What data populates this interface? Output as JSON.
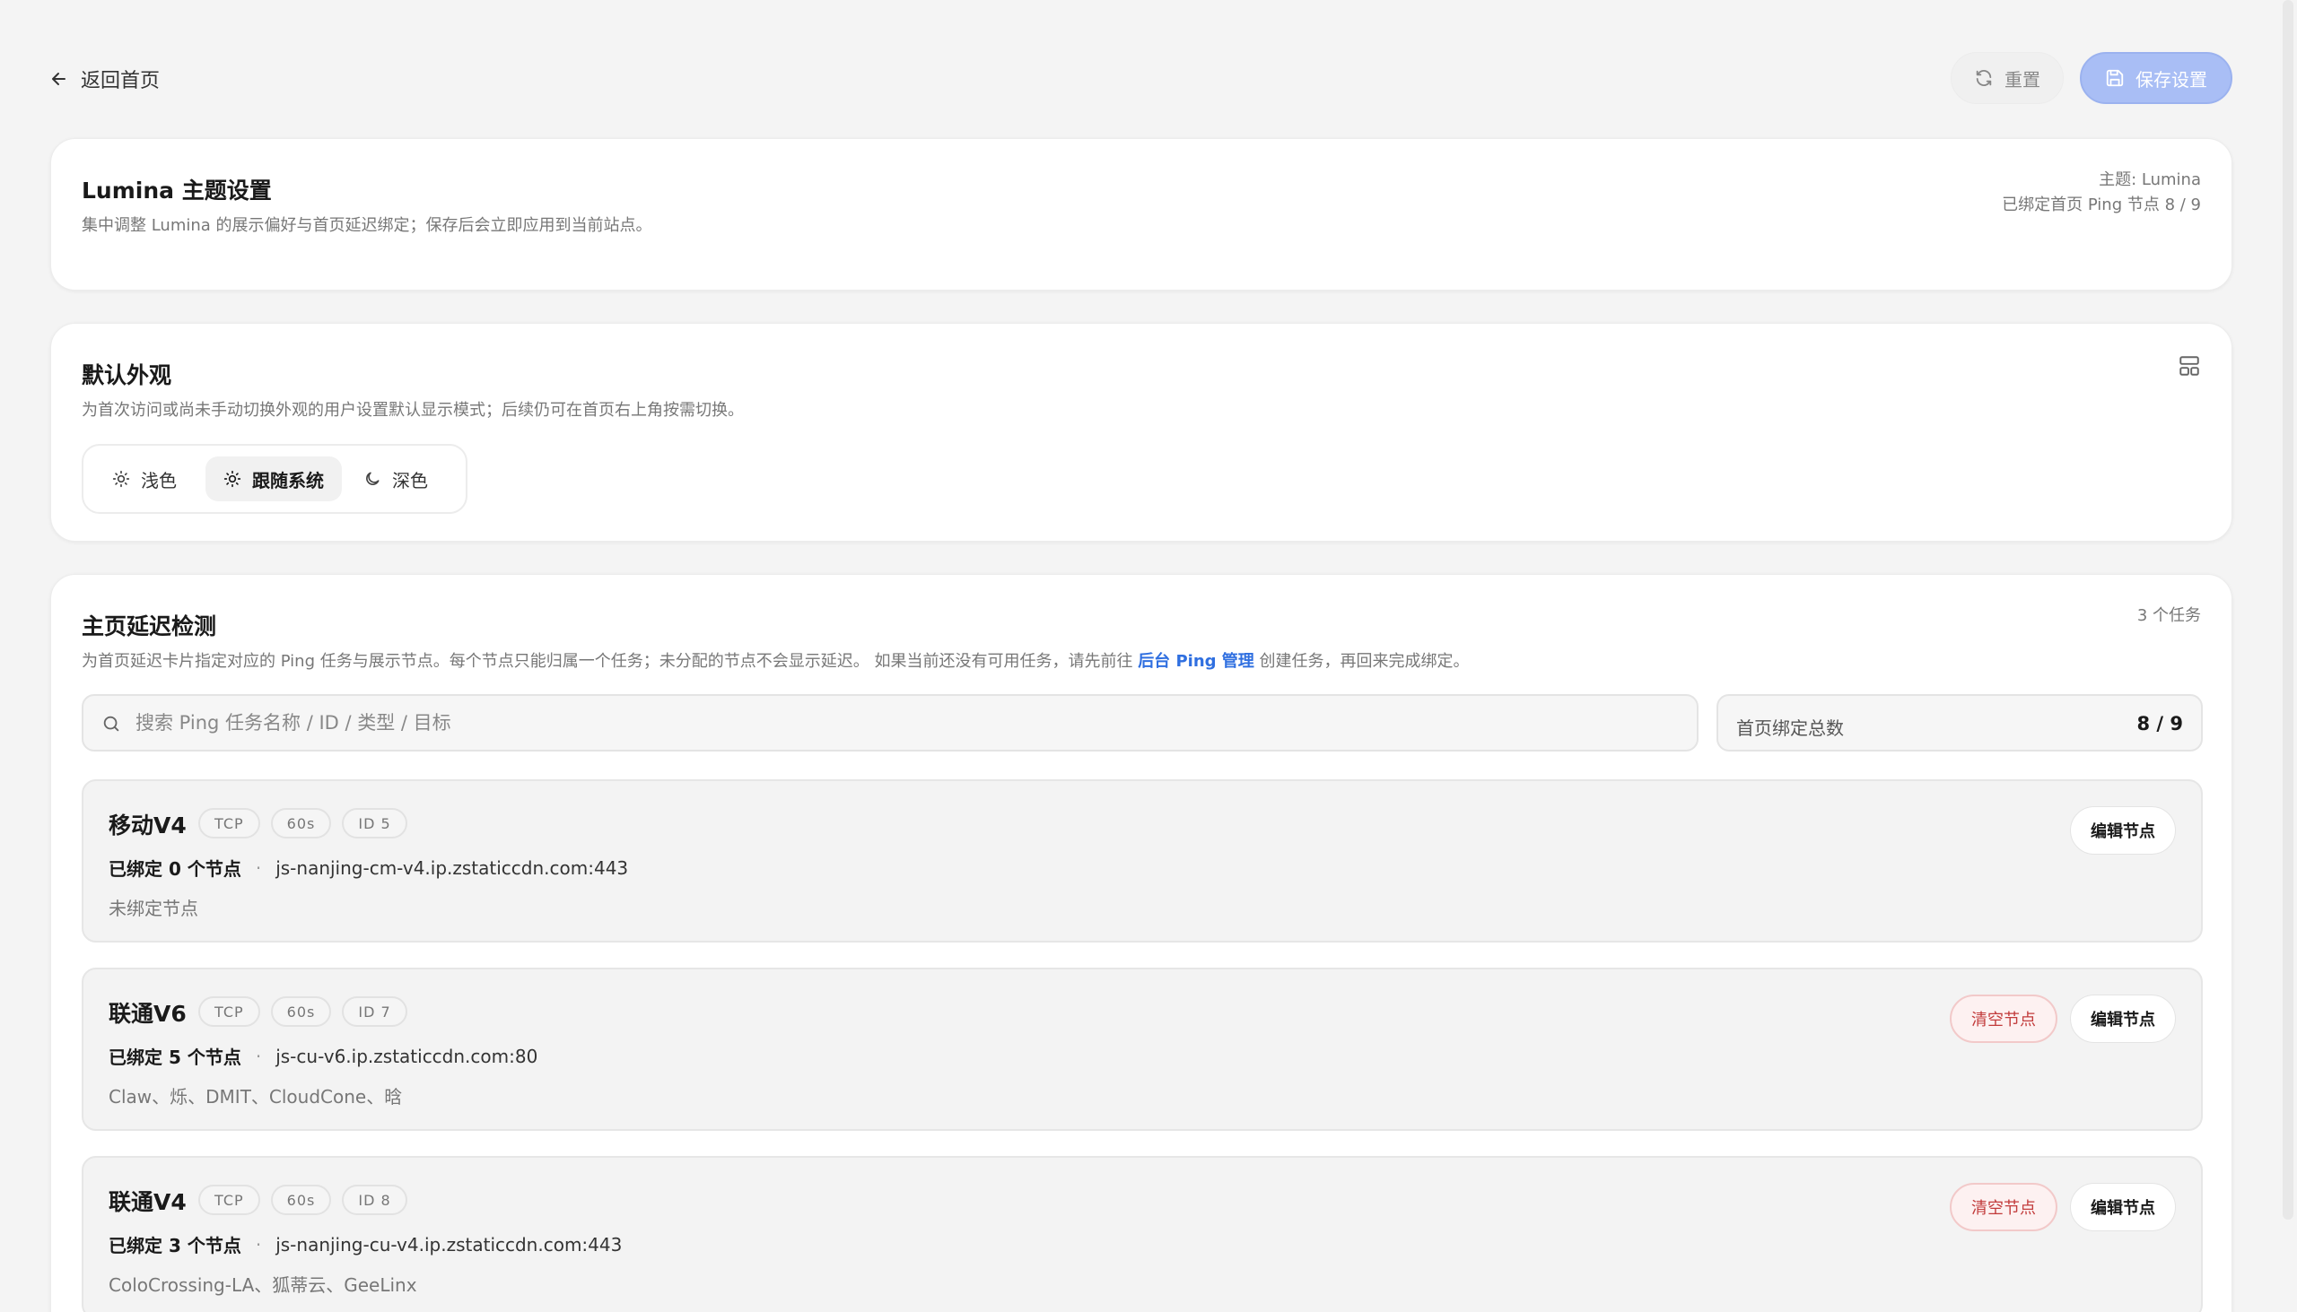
{
  "header": {
    "back_label": "返回首页",
    "reset_label": "重置",
    "save_label": "保存设置"
  },
  "theme_card": {
    "title": "Lumina 主题设置",
    "desc": "集中调整 Lumina 的展示偏好与首页延迟绑定；保存后会立即应用到当前站点。",
    "theme_meta": "主题: Lumina",
    "bound_meta": "已绑定首页 Ping 节点 8 / 9"
  },
  "appearance": {
    "title": "默认外观",
    "desc": "为首次访问或尚未手动切换外观的用户设置默认显示模式；后续仍可在首页右上角按需切换。",
    "options": [
      {
        "label": "浅色",
        "icon": "sun-icon"
      },
      {
        "label": "跟随系统",
        "icon": "sun-system-icon",
        "selected": true
      },
      {
        "label": "深色",
        "icon": "moon-icon"
      }
    ]
  },
  "latency": {
    "title": "主页延迟检测",
    "desc_prefix": "为首页延迟卡片指定对应的 Ping 任务与展示节点。每个节点只能归属一个任务；未分配的节点不会显示延迟。 如果当前还没有可用任务，请先前往 ",
    "desc_link": "后台 Ping 管理",
    "desc_suffix": " 创建任务，再回来完成绑定。",
    "task_count": "3 个任务",
    "search_placeholder": "搜索 Ping 任务名称 / ID / 类型 / 目标",
    "total_label": "首页绑定总数",
    "total_value": "8 / 9",
    "clear_label": "清空节点",
    "edit_label": "编辑节点",
    "tasks": [
      {
        "name": "移动V4",
        "protocol": "TCP",
        "interval": "60s",
        "id": "ID 5",
        "bound": "已绑定 0 个节点",
        "target": "js-nanjing-cm-v4.ip.zstaticcdn.com:443",
        "nodes": "未绑定节点",
        "has_clear": false
      },
      {
        "name": "联通V6",
        "protocol": "TCP",
        "interval": "60s",
        "id": "ID 7",
        "bound": "已绑定 5 个节点",
        "target": "js-cu-v6.ip.zstaticcdn.com:80",
        "nodes": "Claw、烁、DMIT、CloudCone、晗",
        "has_clear": true
      },
      {
        "name": "联通V4",
        "protocol": "TCP",
        "interval": "60s",
        "id": "ID 8",
        "bound": "已绑定 3 个节点",
        "target": "js-nanjing-cu-v4.ip.zstaticcdn.com:443",
        "nodes": "ColoCrossing-LA、狐蒂云、GeeLinx",
        "has_clear": true
      }
    ]
  },
  "colors": {
    "accent": "#2f6fe0",
    "save_button": "#a9bef5",
    "danger": "#c23b3b"
  }
}
